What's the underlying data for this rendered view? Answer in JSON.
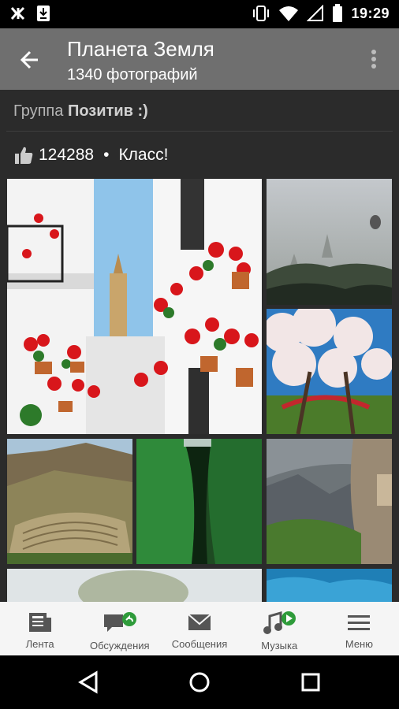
{
  "status": {
    "time": "19:29"
  },
  "header": {
    "title": "Планета Земля",
    "subtitle": "1340 фотографий"
  },
  "group": {
    "prefix": "Группа",
    "name": "Позитив :)"
  },
  "likes": {
    "count": "124288",
    "separator": "•",
    "label": "Класс!"
  },
  "photos": [
    {
      "desc": "white-wall-street-red-flowers"
    },
    {
      "desc": "misty-temples-balloon"
    },
    {
      "desc": "cherry-blossom-bridge"
    },
    {
      "desc": "mountain-terraces"
    },
    {
      "desc": "green-canyon"
    },
    {
      "desc": "alpine-cliff-house"
    },
    {
      "desc": "tree-sky"
    },
    {
      "desc": "blue-ice-cave"
    }
  ],
  "nav": {
    "items": [
      {
        "label": "Лента",
        "icon": "feed-icon"
      },
      {
        "label": "Обсуждения",
        "icon": "discussions-icon"
      },
      {
        "label": "Сообщения",
        "icon": "messages-icon"
      },
      {
        "label": "Музыка",
        "icon": "music-icon"
      },
      {
        "label": "Меню",
        "icon": "menu-icon"
      }
    ]
  },
  "colors": {
    "accent": "#2e9b3a",
    "appbar": "#6f6f6f",
    "background": "#2b2b2b"
  }
}
